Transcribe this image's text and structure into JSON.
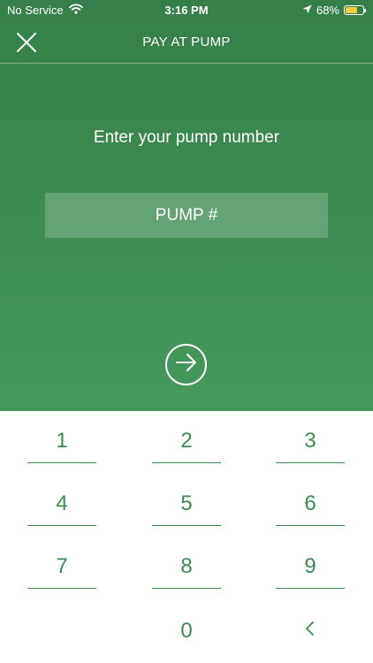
{
  "status_bar": {
    "carrier": "No Service",
    "time": "3:16 PM",
    "battery_pct": "68%",
    "battery_level": 0.68,
    "icons": [
      "wifi-icon",
      "location-arrow-icon",
      "battery-icon"
    ]
  },
  "nav": {
    "title": "PAY AT PUMP",
    "close_icon": "close-icon"
  },
  "main": {
    "prompt": "Enter your pump number",
    "pump_input": {
      "value": "",
      "placeholder": "PUMP #"
    },
    "submit_icon": "arrow-right-circle-icon"
  },
  "keypad": {
    "keys": [
      "1",
      "2",
      "3",
      "4",
      "5",
      "6",
      "7",
      "8",
      "9",
      "0"
    ],
    "backspace_icon": "chevron-left-icon"
  },
  "colors": {
    "header_gradient_top": "#35804a",
    "header_gradient_bottom": "#44995d",
    "accent": "#3e8a52",
    "battery": "#f4d03f"
  }
}
